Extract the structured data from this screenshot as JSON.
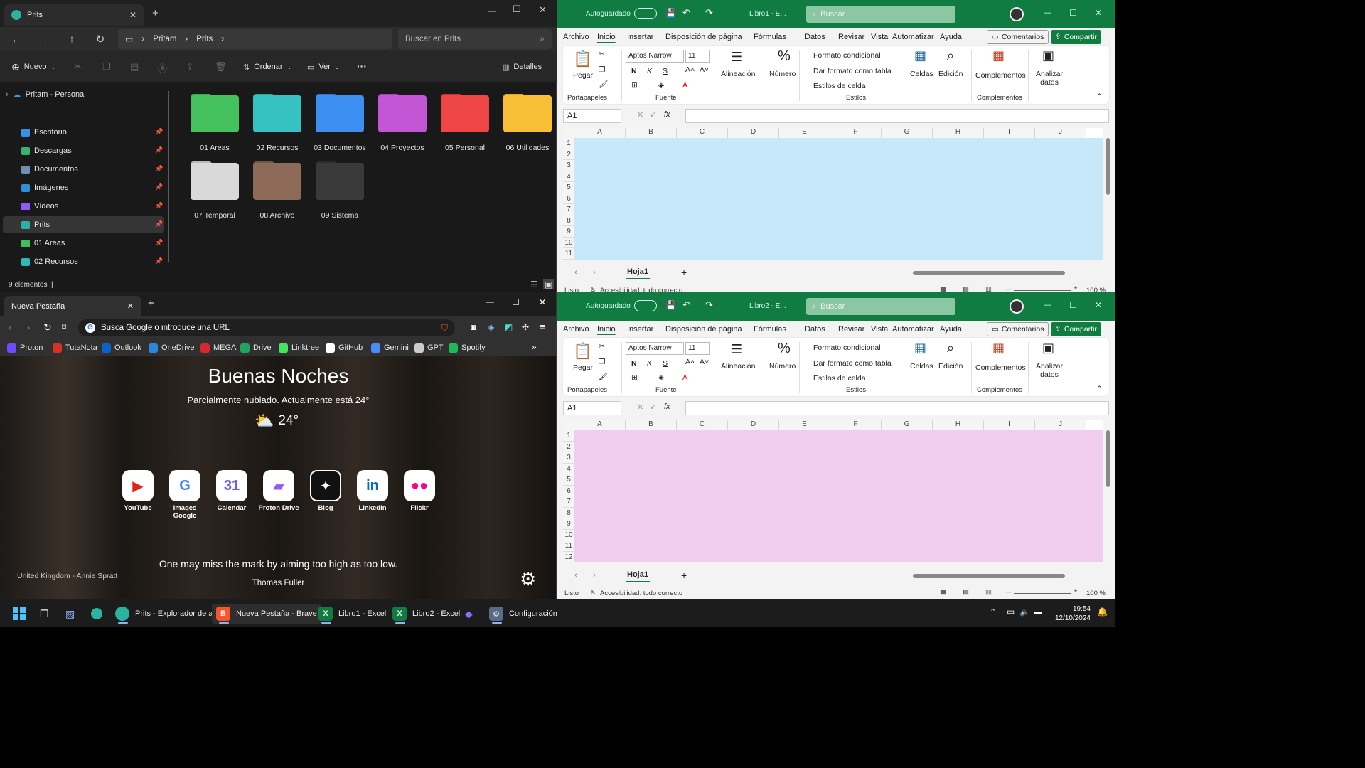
{
  "explorer": {
    "tab_title": "Prits",
    "breadcrumb": [
      "Pritam",
      "Prits"
    ],
    "search_placeholder": "Buscar en Prits",
    "new_label": "Nuevo",
    "sort_label": "Ordenar",
    "view_label": "Ver",
    "more_label": "···",
    "details_label": "Detalles",
    "cloud_label": "Pritam - Personal",
    "sidebar": [
      {
        "label": "Escritorio",
        "color": "#3a8ee6"
      },
      {
        "label": "Descargas",
        "color": "#38b26e"
      },
      {
        "label": "Documentos",
        "color": "#6e8fb4"
      },
      {
        "label": "Imágenes",
        "color": "#2f8fd8"
      },
      {
        "label": "Vídeos",
        "color": "#8b5cf6"
      },
      {
        "label": "Prits",
        "color": "#2bb3a0"
      },
      {
        "label": "01 Areas",
        "color": "#3fbf5a"
      },
      {
        "label": "02 Recursos",
        "color": "#30b7b7"
      }
    ],
    "folders": [
      {
        "label": "01 Areas",
        "color": "#45c15d",
        "tab": "#3aa84f"
      },
      {
        "label": "02 Recursos",
        "color": "#37c2c2",
        "tab": "#2ba4a4"
      },
      {
        "label": "03 Documentos",
        "color": "#3d8ff2",
        "tab": "#2f77d0"
      },
      {
        "label": "04 Proyectos",
        "color": "#c256d4",
        "tab": "#a63fb8"
      },
      {
        "label": "05 Personal",
        "color": "#ee4646",
        "tab": "#c93535"
      },
      {
        "label": "06 Utilidades",
        "color": "#f6bf36",
        "tab": "#e0a61f"
      },
      {
        "label": "07 Temporal",
        "color": "#d9d9d9",
        "tab": "#b9b9b9"
      },
      {
        "label": "08 Archivo",
        "color": "#8c6a57",
        "tab": "#745645"
      },
      {
        "label": "09 Sistema",
        "color": "#3a3a3a",
        "tab": "#2c2c2c"
      }
    ],
    "status": "9 elementos"
  },
  "browser": {
    "tab_title": "Nueva Pestaña",
    "url_placeholder": "Busca Google o introduce una URL",
    "bookmarks": [
      {
        "label": "Proton",
        "color": "#6d4aff"
      },
      {
        "label": "TutaNota",
        "color": "#d93025"
      },
      {
        "label": "Outlook",
        "color": "#0a64c8"
      },
      {
        "label": "OneDrive",
        "color": "#2b88d8"
      },
      {
        "label": "MEGA",
        "color": "#d9272e"
      },
      {
        "label": "Drive",
        "color": "#1fa463"
      },
      {
        "label": "Linktree",
        "color": "#43e660"
      },
      {
        "label": "GitHub",
        "color": "#ffffff"
      },
      {
        "label": "Gemini",
        "color": "#4b8df8"
      },
      {
        "label": "GPT",
        "color": "#cccccc"
      },
      {
        "label": "Spotify",
        "color": "#1db954"
      }
    ],
    "greeting": "Buenas Noches",
    "weather_text": "Parcialmente nublado. Actualmente está 24°",
    "temperature": "24°",
    "tiles": [
      {
        "label": "YouTube",
        "glyph": "▶",
        "color": "#e62117"
      },
      {
        "label": "Images Google",
        "glyph": "G",
        "color": "#4285f4"
      },
      {
        "label": "Calendar",
        "glyph": "31",
        "color": "#6a5cf6"
      },
      {
        "label": "Proton Drive",
        "glyph": "▰",
        "color": "#8f5cf6"
      },
      {
        "label": "Blog",
        "glyph": "✦",
        "color": "#111111"
      },
      {
        "label": "LinkedIn",
        "glyph": "in",
        "color": "#0a66c2"
      },
      {
        "label": "Flickr",
        "glyph": "●●",
        "color": "#ff0084"
      }
    ],
    "photo_credit": "United Kingdom - Annie Spratt",
    "quote": "One may miss the mark by aiming too high as too low.",
    "quote_author": "Thomas Fuller"
  },
  "excel1": {
    "autosave": "Autoguardado",
    "doc_title": "Libro1 - E...",
    "search": "Buscar",
    "fill": "#c7e8f8",
    "rows": [
      "1",
      "2",
      "3",
      "4",
      "5",
      "6",
      "7",
      "8",
      "9",
      "10",
      "11"
    ]
  },
  "excel2": {
    "autosave": "Autoguardado",
    "doc_title": "Libro2 - E...",
    "search": "Buscar",
    "fill": "#f0cdee",
    "rows": [
      "1",
      "2",
      "3",
      "4",
      "5",
      "6",
      "7",
      "8",
      "9",
      "10",
      "11",
      "12"
    ]
  },
  "excel_common": {
    "menu": [
      "Archivo",
      "Inicio",
      "Insertar",
      "Disposición de página",
      "Fórmulas",
      "Datos",
      "Revisar",
      "Vista",
      "Automatizar",
      "Ayuda"
    ],
    "comments": "Comentarios",
    "share": "Compartir",
    "paste": "Pegar",
    "clipboard_group": "Portapapeles",
    "font_name": "Aptos Narrow",
    "font_size": "11",
    "font_group": "Fuente",
    "bold": "N",
    "italic": "K",
    "underline": "S",
    "alignment": "Alineación",
    "number": "Número",
    "cond_format": "Formato condicional",
    "format_table": "Dar formato como tabla",
    "cell_styles": "Estilos de celda",
    "styles_group": "Estilos",
    "cells": "Celdas",
    "editing": "Edición",
    "addins": "Complementos",
    "addins_group": "Complementos",
    "analyze": "Analizar datos",
    "namebox": "A1",
    "fx": "fx",
    "columns": [
      "A",
      "B",
      "C",
      "D",
      "E",
      "F",
      "G",
      "H",
      "I",
      "J"
    ],
    "sheet": "Hoja1",
    "status_ready": "Listo",
    "accessibility": "Accesibilidad: todo correcto",
    "zoom": "100 %"
  },
  "taskbar": {
    "items": [
      {
        "label": "Prits - Explorador de arc",
        "color": "#2bb3a0",
        "glyph": ""
      },
      {
        "label": "Nueva Pestaña - Brave",
        "color": "#fb542b",
        "glyph": "B"
      },
      {
        "label": "Libro1 - Excel",
        "color": "#107c41",
        "glyph": "X"
      },
      {
        "label": "Libro2 - Excel",
        "color": "#107c41",
        "glyph": "X"
      },
      {
        "label": "Configuración",
        "color": "#5a6b86",
        "glyph": "⚙"
      }
    ],
    "time": "19:54",
    "date": "12/10/2024"
  }
}
